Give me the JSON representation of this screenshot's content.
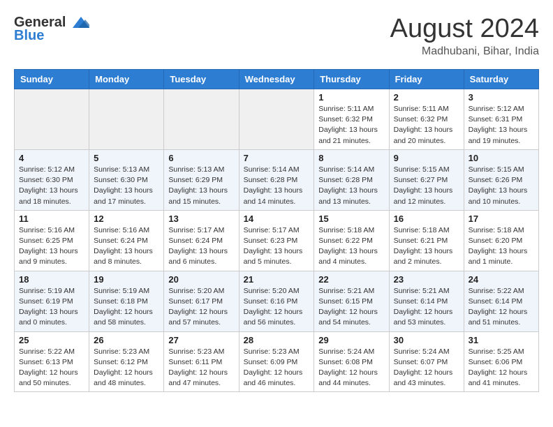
{
  "header": {
    "logo_general": "General",
    "logo_blue": "Blue",
    "month_year": "August 2024",
    "location": "Madhubani, Bihar, India"
  },
  "days_of_week": [
    "Sunday",
    "Monday",
    "Tuesday",
    "Wednesday",
    "Thursday",
    "Friday",
    "Saturday"
  ],
  "weeks": [
    [
      {
        "day": "",
        "info": ""
      },
      {
        "day": "",
        "info": ""
      },
      {
        "day": "",
        "info": ""
      },
      {
        "day": "",
        "info": ""
      },
      {
        "day": "1",
        "info": "Sunrise: 5:11 AM\nSunset: 6:32 PM\nDaylight: 13 hours\nand 21 minutes."
      },
      {
        "day": "2",
        "info": "Sunrise: 5:11 AM\nSunset: 6:32 PM\nDaylight: 13 hours\nand 20 minutes."
      },
      {
        "day": "3",
        "info": "Sunrise: 5:12 AM\nSunset: 6:31 PM\nDaylight: 13 hours\nand 19 minutes."
      }
    ],
    [
      {
        "day": "4",
        "info": "Sunrise: 5:12 AM\nSunset: 6:30 PM\nDaylight: 13 hours\nand 18 minutes."
      },
      {
        "day": "5",
        "info": "Sunrise: 5:13 AM\nSunset: 6:30 PM\nDaylight: 13 hours\nand 17 minutes."
      },
      {
        "day": "6",
        "info": "Sunrise: 5:13 AM\nSunset: 6:29 PM\nDaylight: 13 hours\nand 15 minutes."
      },
      {
        "day": "7",
        "info": "Sunrise: 5:14 AM\nSunset: 6:28 PM\nDaylight: 13 hours\nand 14 minutes."
      },
      {
        "day": "8",
        "info": "Sunrise: 5:14 AM\nSunset: 6:28 PM\nDaylight: 13 hours\nand 13 minutes."
      },
      {
        "day": "9",
        "info": "Sunrise: 5:15 AM\nSunset: 6:27 PM\nDaylight: 13 hours\nand 12 minutes."
      },
      {
        "day": "10",
        "info": "Sunrise: 5:15 AM\nSunset: 6:26 PM\nDaylight: 13 hours\nand 10 minutes."
      }
    ],
    [
      {
        "day": "11",
        "info": "Sunrise: 5:16 AM\nSunset: 6:25 PM\nDaylight: 13 hours\nand 9 minutes."
      },
      {
        "day": "12",
        "info": "Sunrise: 5:16 AM\nSunset: 6:24 PM\nDaylight: 13 hours\nand 8 minutes."
      },
      {
        "day": "13",
        "info": "Sunrise: 5:17 AM\nSunset: 6:24 PM\nDaylight: 13 hours\nand 6 minutes."
      },
      {
        "day": "14",
        "info": "Sunrise: 5:17 AM\nSunset: 6:23 PM\nDaylight: 13 hours\nand 5 minutes."
      },
      {
        "day": "15",
        "info": "Sunrise: 5:18 AM\nSunset: 6:22 PM\nDaylight: 13 hours\nand 4 minutes."
      },
      {
        "day": "16",
        "info": "Sunrise: 5:18 AM\nSunset: 6:21 PM\nDaylight: 13 hours\nand 2 minutes."
      },
      {
        "day": "17",
        "info": "Sunrise: 5:18 AM\nSunset: 6:20 PM\nDaylight: 13 hours\nand 1 minute."
      }
    ],
    [
      {
        "day": "18",
        "info": "Sunrise: 5:19 AM\nSunset: 6:19 PM\nDaylight: 13 hours\nand 0 minutes."
      },
      {
        "day": "19",
        "info": "Sunrise: 5:19 AM\nSunset: 6:18 PM\nDaylight: 12 hours\nand 58 minutes."
      },
      {
        "day": "20",
        "info": "Sunrise: 5:20 AM\nSunset: 6:17 PM\nDaylight: 12 hours\nand 57 minutes."
      },
      {
        "day": "21",
        "info": "Sunrise: 5:20 AM\nSunset: 6:16 PM\nDaylight: 12 hours\nand 56 minutes."
      },
      {
        "day": "22",
        "info": "Sunrise: 5:21 AM\nSunset: 6:15 PM\nDaylight: 12 hours\nand 54 minutes."
      },
      {
        "day": "23",
        "info": "Sunrise: 5:21 AM\nSunset: 6:14 PM\nDaylight: 12 hours\nand 53 minutes."
      },
      {
        "day": "24",
        "info": "Sunrise: 5:22 AM\nSunset: 6:14 PM\nDaylight: 12 hours\nand 51 minutes."
      }
    ],
    [
      {
        "day": "25",
        "info": "Sunrise: 5:22 AM\nSunset: 6:13 PM\nDaylight: 12 hours\nand 50 minutes."
      },
      {
        "day": "26",
        "info": "Sunrise: 5:23 AM\nSunset: 6:12 PM\nDaylight: 12 hours\nand 48 minutes."
      },
      {
        "day": "27",
        "info": "Sunrise: 5:23 AM\nSunset: 6:11 PM\nDaylight: 12 hours\nand 47 minutes."
      },
      {
        "day": "28",
        "info": "Sunrise: 5:23 AM\nSunset: 6:09 PM\nDaylight: 12 hours\nand 46 minutes."
      },
      {
        "day": "29",
        "info": "Sunrise: 5:24 AM\nSunset: 6:08 PM\nDaylight: 12 hours\nand 44 minutes."
      },
      {
        "day": "30",
        "info": "Sunrise: 5:24 AM\nSunset: 6:07 PM\nDaylight: 12 hours\nand 43 minutes."
      },
      {
        "day": "31",
        "info": "Sunrise: 5:25 AM\nSunset: 6:06 PM\nDaylight: 12 hours\nand 41 minutes."
      }
    ]
  ]
}
